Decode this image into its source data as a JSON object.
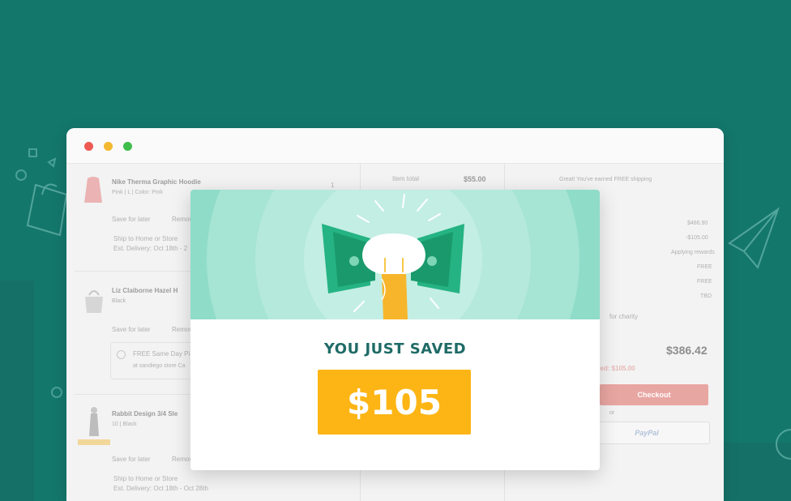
{
  "browser": {
    "window_dots": [
      "close-dot",
      "minimize-dot",
      "maximize-dot"
    ],
    "dot_colors": [
      "#ee5a52",
      "#f4b731",
      "#3fbe4b"
    ]
  },
  "cart": {
    "items": [
      {
        "name": "Nike Therma Graphic Hoodie",
        "meta": "Pink | L | Color: Pink",
        "save_label": "Save for later",
        "remove_label": "Remove",
        "ship_label": "Ship to Home or Store",
        "delivery": "Est. Delivery: Oct 18th - 2",
        "qty": "1"
      },
      {
        "name": "Liz Claiborne Hazel H",
        "meta": "Black",
        "save_label": "Save for later",
        "remove_label": "Remove",
        "pickup_label": "FREE Same Day Pi",
        "pickup_meta": "at sandiego store Ca"
      },
      {
        "name": "Rabbit Design 3/4 Sle",
        "meta": "10 | Black",
        "save_label": "Save for later",
        "remove_label": "Remove",
        "ship_label": "Ship to Home or Store",
        "delivery": "Est. Delivery: Oct 18th - Oct 28th"
      }
    ],
    "item_total_label": "Item total",
    "item_total_value": "$55.00"
  },
  "summary": {
    "promo": "Great! You've earned FREE shipping",
    "lines": [
      "$486.90",
      "-$105.00",
      "Applying rewards",
      "FREE",
      "FREE",
      "TBD"
    ],
    "charity_label": "for charity",
    "total": "$386.42",
    "saved_label": "ved: $105.00",
    "checkout_label": "Checkout",
    "or_label": "or",
    "paypal_label": "PayPal"
  },
  "modal": {
    "title": "YOU JUST SAVED",
    "amount": "$105",
    "colors": {
      "banner": "#8fdcc9",
      "amount_bg": "#fdb515",
      "title": "#1f6b67"
    },
    "illustration": "hand-holding-money-icon"
  },
  "colors": {
    "background": "#14776c"
  }
}
